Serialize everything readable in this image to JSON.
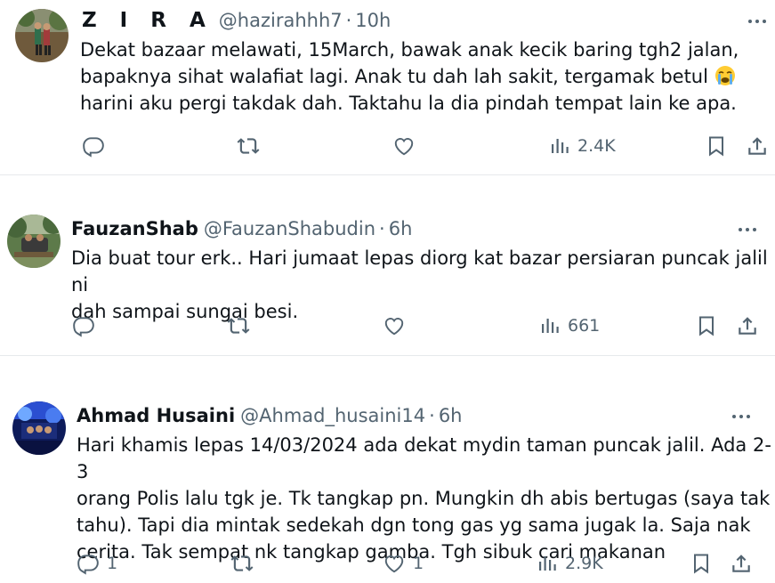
{
  "tweets": [
    {
      "name": "Z I R A",
      "handle": "@hazirahhh7",
      "dot": "·",
      "time": "10h",
      "text": "Dekat bazaar melawati, 15March, bawak anak kecik baring tgh2 jalan,\nbapaknya sihat walafiat lagi. Anak tu dah lah sakit, tergamak betul ",
      "text_after": "\nharini aku pergi takdak dah. Taktahu la dia pindah tempat lain ke apa.",
      "emoji": "loudly-crying-face",
      "replies": "",
      "retweets": "",
      "likes": "",
      "views": "2.4K"
    },
    {
      "name": "FauzanShab",
      "handle": "@FauzanShabudin",
      "dot": "·",
      "time": "6h",
      "text": "Dia buat tour erk.. Hari jumaat lepas diorg kat bazar persiaran puncak jalil ni\ndah sampai sungai besi.",
      "replies": "",
      "retweets": "",
      "likes": "",
      "views": "661"
    },
    {
      "name": "Ahmad Husaini",
      "handle": "@Ahmad_husaini14",
      "dot": "·",
      "time": "6h",
      "text": "Hari khamis lepas 14/03/2024 ada dekat mydin taman puncak jalil. Ada 2-3\norang Polis lalu tgk je. Tk tangkap pn. Mungkin dh abis bertugas (saya tak\ntahu). Tapi dia mintak sedekah dgn tong gas yg sama jugak la. Saja nak\ncerita. Tak sempat nk tangkap gamba. Tgh sibuk cari makanan",
      "replies": "1",
      "retweets": "",
      "likes": "1",
      "views": "2.9K"
    }
  ],
  "icons": {
    "reply": "reply-icon",
    "retweet": "retweet-icon",
    "like": "like-icon",
    "views": "views-icon",
    "bookmark": "bookmark-icon",
    "share": "share-icon",
    "more": "more-icon"
  },
  "colors": {
    "text": "#0f1419",
    "secondary": "#536471",
    "divider": "#eff3f4"
  }
}
